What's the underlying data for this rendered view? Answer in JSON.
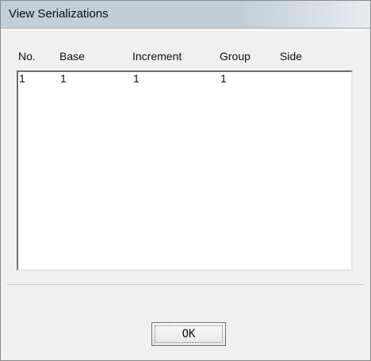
{
  "window": {
    "title": "View Serializations"
  },
  "list": {
    "columns": [
      "No.",
      "Base",
      "Increment",
      "Group",
      "Side"
    ],
    "rows": [
      [
        "1",
        "1",
        "1",
        "1",
        ""
      ]
    ]
  },
  "buttons": {
    "ok_label": "OK"
  }
}
